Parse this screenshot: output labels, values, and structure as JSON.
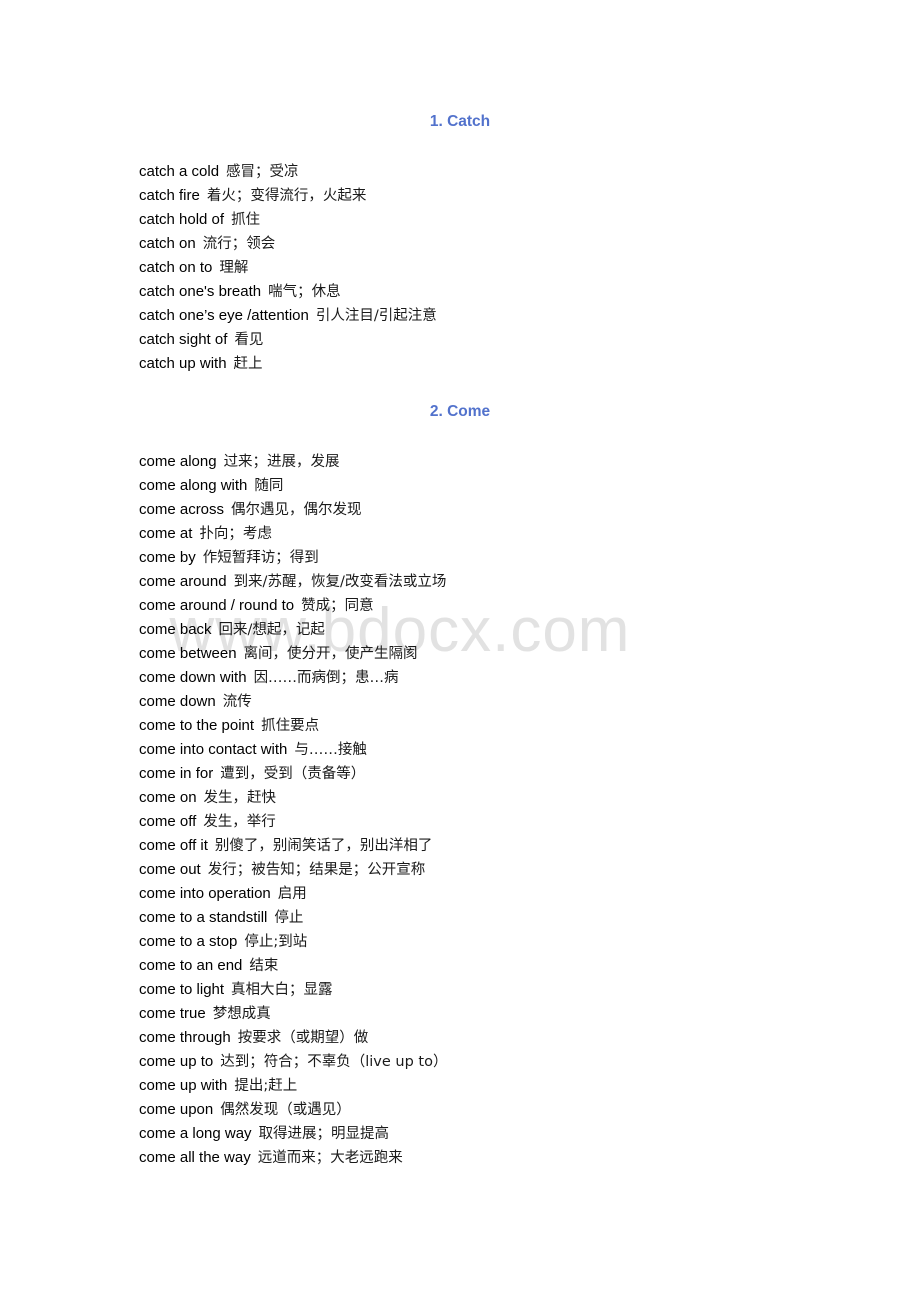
{
  "document": {
    "watermark": "www.bdocx.com",
    "heading_color": "#5272cc",
    "text_color": "#000000",
    "background_color": "#ffffff"
  },
  "sections": [
    {
      "heading": "1. Catch",
      "entries": [
        {
          "en": "catch a cold",
          "zh": "感冒；受凉"
        },
        {
          "en": "catch fire",
          "zh": "着火；变得流行，火起来"
        },
        {
          "en": "catch hold of",
          "zh": "抓住"
        },
        {
          "en": "catch on",
          "zh": "流行；领会"
        },
        {
          "en": "catch on to",
          "zh": "理解"
        },
        {
          "en": "catch one's breath",
          "zh": "喘气；休息"
        },
        {
          "en": "catch one’s eye /attention",
          "zh": "引人注目/引起注意"
        },
        {
          "en": "catch sight of",
          "zh": "看见"
        },
        {
          "en": "catch up with",
          "zh": "赶上"
        }
      ]
    },
    {
      "heading": "2. Come",
      "entries": [
        {
          "en": "come along",
          "zh": "过来；进展，发展"
        },
        {
          "en": "come along with",
          "zh": "随同"
        },
        {
          "en": "come across",
          "zh": "偶尔遇见，偶尔发现"
        },
        {
          "en": "come at",
          "zh": "扑向；考虑"
        },
        {
          "en": "come by",
          "zh": "作短暂拜访；得到"
        },
        {
          "en": "come around",
          "zh": "到来/苏醒，恢复/改变看法或立场"
        },
        {
          "en": "come around / round to",
          "zh": "赞成；同意"
        },
        {
          "en": "come back",
          "zh": "回来/想起，记起"
        },
        {
          "en": "come between",
          "zh": "离间，使分开，使产生隔阂"
        },
        {
          "en": "come down with",
          "zh": "因……而病倒；患…病"
        },
        {
          "en": "come down",
          "zh": "流传"
        },
        {
          "en": "come to the point",
          "zh": "抓住要点"
        },
        {
          "en": "come into contact with",
          "zh": "与……接触"
        },
        {
          "en": "come in for",
          "zh": "遭到，受到（责备等）"
        },
        {
          "en": "come on",
          "zh": "发生，赶快"
        },
        {
          "en": "come off",
          "zh": "发生，举行"
        },
        {
          "en": "come off it",
          "zh": "别傻了，别闹笑话了，别出洋相了"
        },
        {
          "en": "come out",
          "zh": "发行；被告知；结果是；公开宣称"
        },
        {
          "en": "come into operation",
          "zh": "启用"
        },
        {
          "en": "come to a standstill",
          "zh": "停止"
        },
        {
          "en": "come to a stop",
          "zh": "停止;到站"
        },
        {
          "en": "come to an end",
          "zh": "结束"
        },
        {
          "en": "come to light",
          "zh": "真相大白；显露"
        },
        {
          "en": "come true",
          "zh": "梦想成真"
        },
        {
          "en": "come through",
          "zh": "按要求（或期望）做"
        },
        {
          "en": "come up to",
          "zh": "达到；符合；不辜负（live up to）"
        },
        {
          "en": "come up with",
          "zh": "提出;赶上"
        },
        {
          "en": "come upon",
          "zh": "偶然发现（或遇见）"
        },
        {
          "en": "come a long way",
          "zh": "取得进展；明显提高"
        },
        {
          "en": "come all the way",
          "zh": "远道而来；大老远跑来"
        }
      ]
    }
  ]
}
